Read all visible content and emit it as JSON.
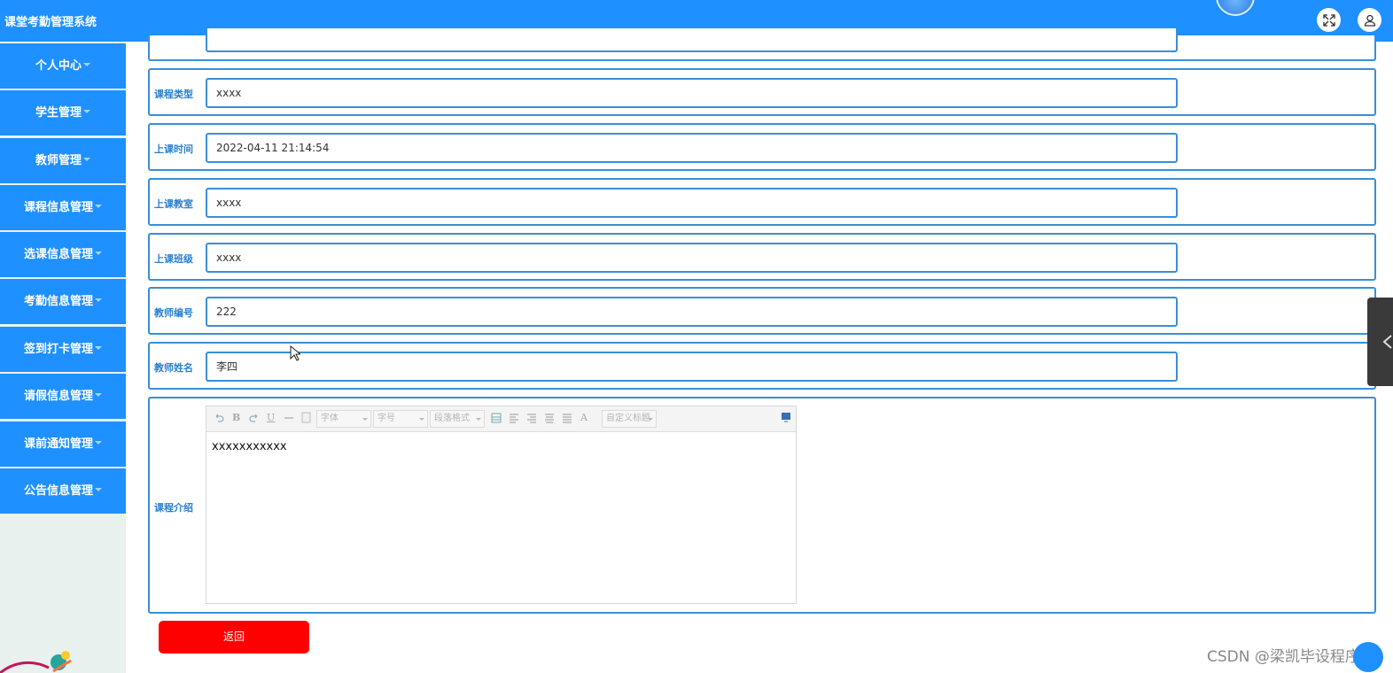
{
  "app": {
    "title": "课堂考勤管理系统"
  },
  "header": {
    "fullscreen_icon": "expand-icon",
    "user_icon": "user-icon"
  },
  "sidebar": {
    "items": [
      {
        "label": "个人中心"
      },
      {
        "label": "学生管理"
      },
      {
        "label": "教师管理"
      },
      {
        "label": "课程信息管理"
      },
      {
        "label": "选课信息管理"
      },
      {
        "label": "考勤信息管理"
      },
      {
        "label": "签到打卡管理"
      },
      {
        "label": "请假信息管理"
      },
      {
        "label": "课前通知管理"
      },
      {
        "label": "公告信息管理"
      }
    ]
  },
  "form": {
    "fields": [
      {
        "label": "课程类型",
        "value": "xxxx"
      },
      {
        "label": "上课时间",
        "value": "2022-04-11 21:14:54"
      },
      {
        "label": "上课教室",
        "value": "xxxx"
      },
      {
        "label": "上课班级",
        "value": "xxxx"
      },
      {
        "label": "教师编号",
        "value": "222"
      },
      {
        "label": "教师姓名",
        "value": "李四"
      }
    ],
    "intro": {
      "label": "课程介绍",
      "content": "xxxxxxxxxxx",
      "toolbar": {
        "bold": "B",
        "underline": "U",
        "font_family": "字体",
        "font_size": "字号",
        "paragraph": "段落格式",
        "font_color": "A",
        "custom_title": "自定义标题"
      }
    },
    "back_label": "返回"
  },
  "watermark": "CSDN @梁凯毕设程序",
  "colors": {
    "primary": "#1e90ff",
    "border": "#3a8fd6",
    "danger": "#ff0000"
  }
}
